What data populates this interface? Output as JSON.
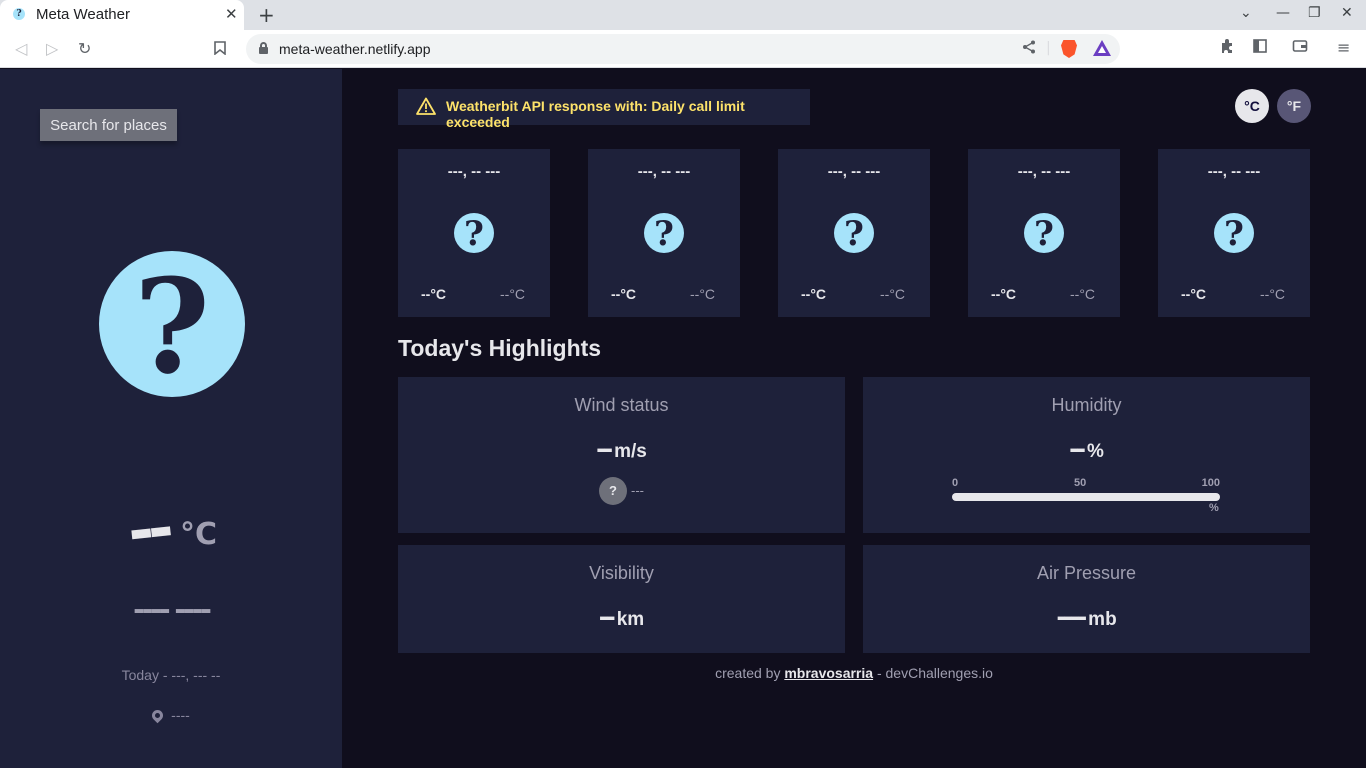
{
  "browser": {
    "tab_title": "Meta Weather",
    "favicon_glyph": "?",
    "close_glyph": "✕",
    "new_tab_glyph": "+",
    "url": "meta-weather.netlify.app",
    "icons": {
      "back": "◁",
      "forward": "▷",
      "reload": "↻",
      "bookmark": "🔖",
      "share": "⤴",
      "extensions": "⧉",
      "sidebar": "▣",
      "wallet": "▭",
      "menu": "≡",
      "minimize": "—",
      "restore": "❐",
      "close": "✕",
      "tablist": "⌄"
    }
  },
  "sidebar": {
    "search_label": "Search for places",
    "icon_glyph": "?",
    "temp": "--",
    "unit": "°C",
    "condition": "---- ----",
    "today": "Today - ---, --- --",
    "location": "----"
  },
  "alert": {
    "text": "Weatherbit API response with: Daily call limit exceeded"
  },
  "units": {
    "celsius": "°C",
    "fahrenheit": "°F"
  },
  "forecast": [
    {
      "date": "---, -- ---",
      "icon": "?",
      "max": "--°C",
      "min": "--°C"
    },
    {
      "date": "---, -- ---",
      "icon": "?",
      "max": "--°C",
      "min": "--°C"
    },
    {
      "date": "---, -- ---",
      "icon": "?",
      "max": "--°C",
      "min": "--°C"
    },
    {
      "date": "---, -- ---",
      "icon": "?",
      "max": "--°C",
      "min": "--°C"
    },
    {
      "date": "---, -- ---",
      "icon": "?",
      "max": "--°C",
      "min": "--°C"
    }
  ],
  "highlights": {
    "title": "Today's Highlights",
    "wind": {
      "title": "Wind status",
      "value": "--",
      "unit": "m/s",
      "dir_icon": "?",
      "direction": "---"
    },
    "humidity": {
      "title": "Humidity",
      "value": "--",
      "unit": "%",
      "scale": [
        "0",
        "50",
        "100"
      ],
      "scale_unit": "%",
      "level": 0
    },
    "visibility": {
      "title": "Visibility",
      "value": "--",
      "unit": "km"
    },
    "pressure": {
      "title": "Air Pressure",
      "value": "----",
      "unit": "mb"
    }
  },
  "footer": {
    "prefix": "created by",
    "author": "mbravosarria",
    "suffix": "- devChallenges.io"
  },
  "colors": {
    "sidebar_bg": "#1e213a",
    "main_bg": "#100e1d",
    "icon_bg": "#a6e3fa",
    "alert_text": "#fde26a",
    "bar_fill": "#ffec65"
  }
}
